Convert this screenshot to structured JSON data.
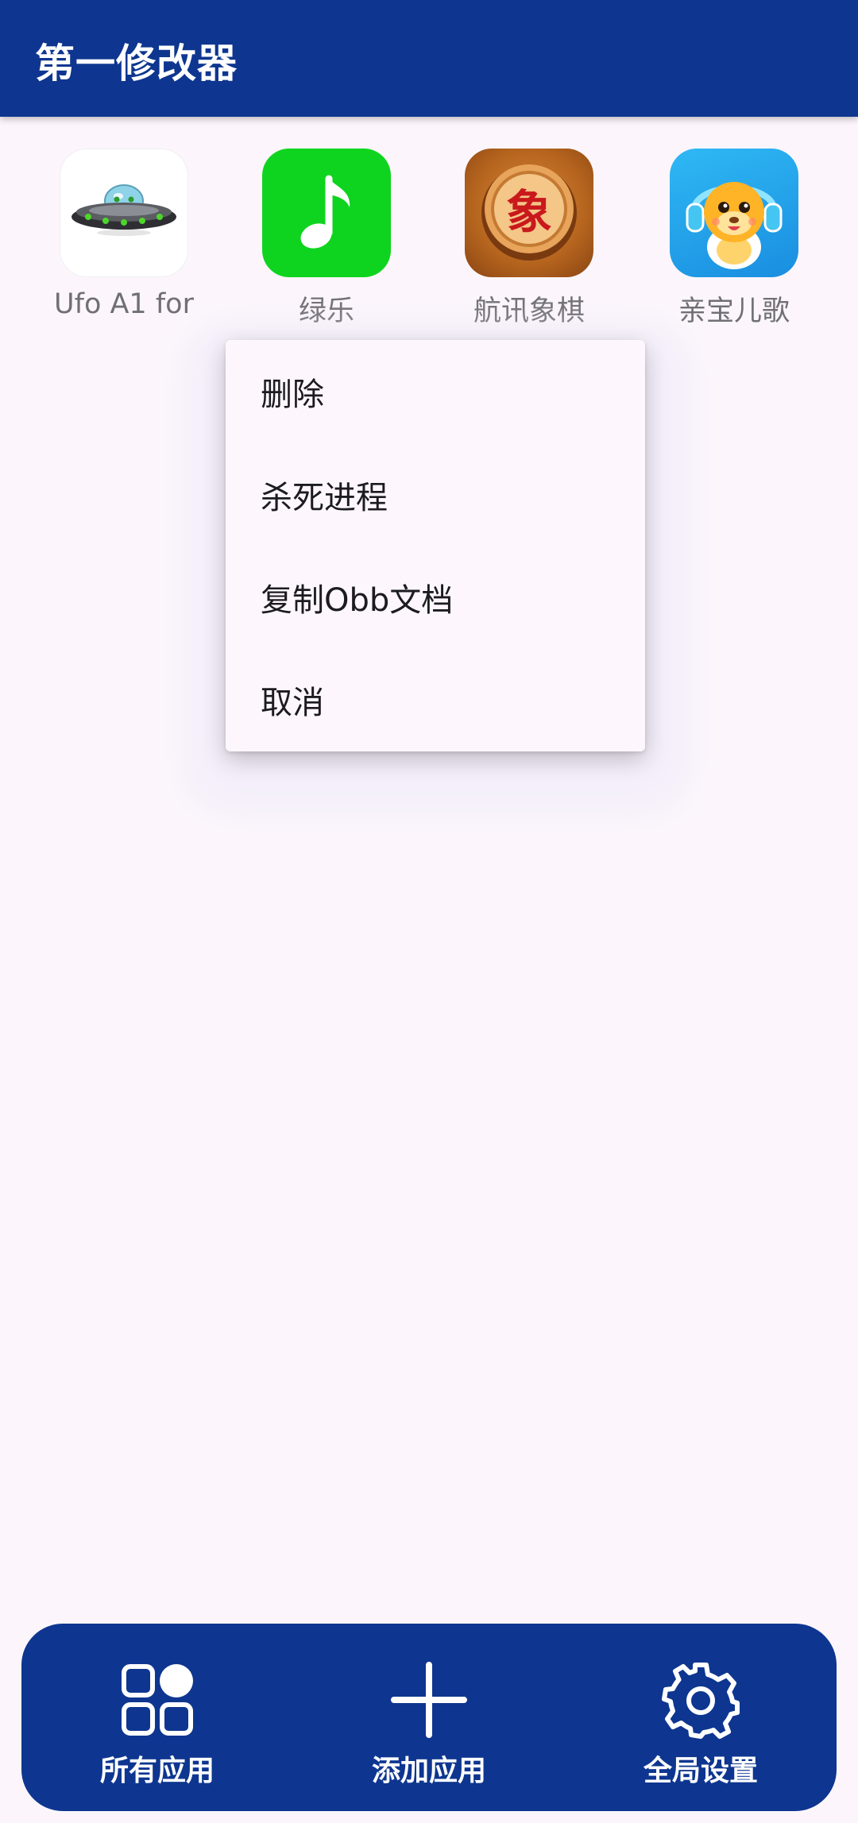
{
  "app_bar": {
    "title": "第一修改器"
  },
  "apps": [
    {
      "label": "Ufo A1 for",
      "icon": "ufo-icon"
    },
    {
      "label": "绿乐",
      "icon": "music-note-icon"
    },
    {
      "label": "航讯象棋",
      "icon": "chinese-chess-icon",
      "glyph": "象"
    },
    {
      "label": "亲宝儿歌",
      "icon": "kids-song-icon"
    }
  ],
  "context_menu": {
    "items": [
      {
        "label": "删除"
      },
      {
        "label": "杀死进程"
      },
      {
        "label": "复制Obb文档"
      },
      {
        "label": "取消"
      }
    ]
  },
  "bottom_nav": {
    "items": [
      {
        "label": "所有应用",
        "icon": "grid-apps-icon"
      },
      {
        "label": "添加应用",
        "icon": "plus-icon"
      },
      {
        "label": "全局设置",
        "icon": "gear-icon"
      }
    ]
  },
  "colors": {
    "primary": "#0e3690",
    "background": "#fcf6fc",
    "music_icon": "#0fd41f"
  }
}
